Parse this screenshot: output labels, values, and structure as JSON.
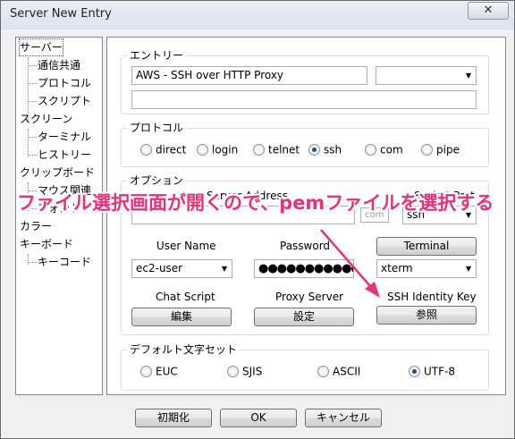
{
  "window": {
    "title": "Server New Entry",
    "close_glyph": "✕"
  },
  "tree": {
    "items": [
      {
        "label": "サーバー"
      },
      {
        "label": "通信共通"
      },
      {
        "label": "プロトコル"
      },
      {
        "label": "スクリプト"
      },
      {
        "label": "スクリーン"
      },
      {
        "label": "ターミナル"
      },
      {
        "label": "ヒストリー"
      },
      {
        "label": "クリップボード"
      },
      {
        "label": "マウス関連"
      },
      {
        "label": "フォント"
      },
      {
        "label": "カラー"
      },
      {
        "label": "キーボード"
      },
      {
        "label": "キーコード"
      }
    ]
  },
  "entry": {
    "legend": "エントリー",
    "name_value": "AWS - SSH over HTTP Proxy",
    "group_value": "",
    "memo_value": ""
  },
  "protocol": {
    "legend": "プロトコル",
    "options": [
      "direct",
      "login",
      "telnet",
      "ssh",
      "com",
      "pipe"
    ],
    "selected": "ssh"
  },
  "options": {
    "legend": "オプション",
    "server_address_label": "Server Address",
    "socket_port_label": "Socket Port",
    "socket_port_value": "ssh",
    "com_value": "com",
    "user_name_label": "User Name",
    "user_name_value": "ec2-user",
    "password_label": "Password",
    "password_value": "●●●●●●●●●●●●●",
    "terminal_button": "Terminal",
    "terminal_value": "xterm",
    "chat_script_label": "Chat Script",
    "chat_script_button": "編集",
    "proxy_server_label": "Proxy Server",
    "proxy_server_button": "設定",
    "ssh_key_label": "SSH Identity Key",
    "ssh_key_button": "参照"
  },
  "charset": {
    "legend": "デフォルト文字セット",
    "options": [
      "EUC",
      "SJIS",
      "ASCII",
      "UTF-8"
    ],
    "selected": "UTF-8"
  },
  "footer": {
    "init_button": "初期化",
    "ok_button": "OK",
    "cancel_button": "キャンセル"
  },
  "annotation": {
    "text": "ファイル選択画面が開くので、pemファイルを選択する",
    "color": "#e8317a"
  }
}
